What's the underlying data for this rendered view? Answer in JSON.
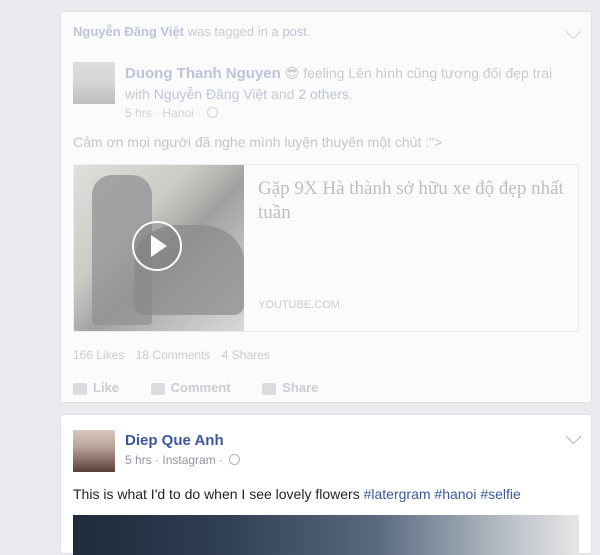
{
  "post1": {
    "tagged_by": "Nguyễn Đăng Việt",
    "tagged_rest": " was tagged in a ",
    "tagged_post": "post",
    "tagged_end": ".",
    "author": "Duong Thanh Nguyen",
    "emoji": "😎",
    "feeling_text": " feeling Lên hình cũng tương đối đẹp trai with ",
    "with_name": "Nguyễn Đăng Việt",
    "and_text": " and ",
    "others": "2 others",
    "period": ".",
    "time": "5 hrs",
    "location": "Hanoi",
    "body": "Cảm ơn mọi người đã nghe mình luyện thuyên một chút :\">",
    "share_title": "Gặp 9X Hà thành sở hữu xe độ đẹp nhất tuần",
    "share_source": "YOUTUBE.COM",
    "likes": "166 Likes",
    "comments": "18 Comments",
    "shares": "4 Shares",
    "actions": {
      "like": "Like",
      "comment": "Comment",
      "share": "Share"
    }
  },
  "post2": {
    "author": "Diep Que Anh",
    "time": "5 hrs",
    "source": "Instagram",
    "body_text": "This is what I'd to do when I see lovely flowers ",
    "hashtags": [
      "#latergram",
      "#hanoi",
      "#selfie"
    ]
  },
  "colors": {
    "link": "#3b5998",
    "muted_link": "#8c9cbf",
    "background": "#e9ebee"
  }
}
